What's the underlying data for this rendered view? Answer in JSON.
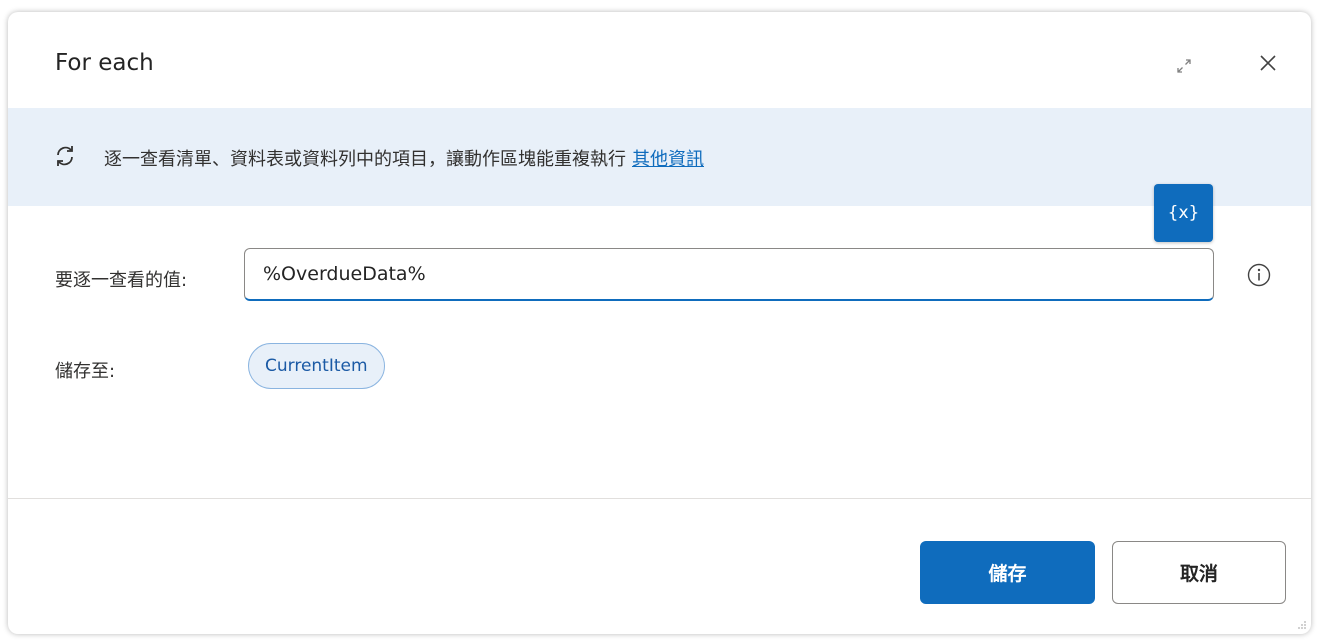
{
  "dialog": {
    "title": "For each"
  },
  "banner": {
    "icon": "loop-icon",
    "text": "逐一查看清單、資料表或資料列中的項目，讓動作區塊能重複執行",
    "link_label": "其他資訊"
  },
  "variables_button": {
    "label": "{x}"
  },
  "fields": {
    "value_label": "要逐一查看的值:",
    "value_input": "%OverdueData%",
    "store_label": "儲存至:",
    "store_variable": "CurrentItem"
  },
  "footer": {
    "save_label": "儲存",
    "cancel_label": "取消"
  },
  "colors": {
    "accent": "#0f6cbd",
    "banner_bg": "#e8f0f9"
  }
}
